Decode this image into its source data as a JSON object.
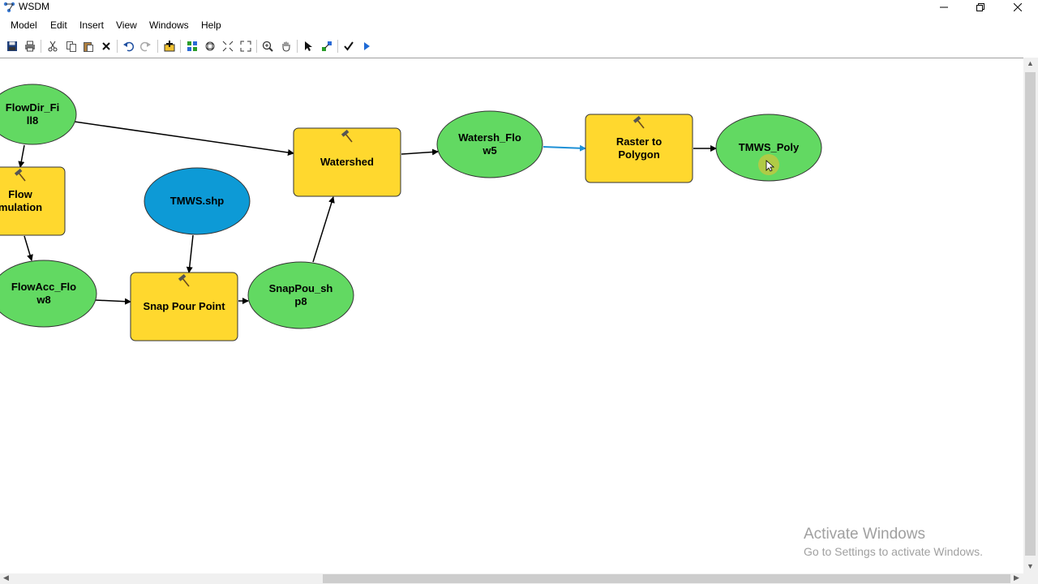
{
  "window": {
    "title": "WSDM",
    "minimize_label": "minimize",
    "maximize_label": "restore",
    "close_label": "close"
  },
  "menu": [
    "Model",
    "Edit",
    "Insert",
    "View",
    "Windows",
    "Help"
  ],
  "toolbar": [
    {
      "icon": "save-icon"
    },
    {
      "icon": "print-icon"
    },
    {
      "icon": "cut-icon"
    },
    {
      "icon": "copy-icon"
    },
    {
      "icon": "paste-icon"
    },
    {
      "icon": "delete-icon"
    },
    {
      "icon": "undo-icon"
    },
    {
      "icon": "redo-icon"
    },
    {
      "icon": "add-data-icon"
    },
    {
      "icon": "auto-layout-icon"
    },
    {
      "icon": "full-extent-icon"
    },
    {
      "icon": "fixed-zoom-in-icon"
    },
    {
      "icon": "fixed-zoom-out-icon"
    },
    {
      "icon": "zoom-in-icon"
    },
    {
      "icon": "pan-icon"
    },
    {
      "icon": "select-icon"
    },
    {
      "icon": "connect-icon"
    },
    {
      "icon": "validate-icon"
    },
    {
      "icon": "run-icon"
    }
  ],
  "model": {
    "nodes": [
      {
        "id": "flowdir",
        "shape": "ellipse",
        "kind": "data",
        "lines": [
          "FlowDir_Fi",
          "ll8"
        ],
        "color": "#62d962"
      },
      {
        "id": "flowacc_tool",
        "shape": "rect",
        "kind": "tool",
        "lines": [
          "Flow",
          "mulation"
        ],
        "color": "#ffd82e"
      },
      {
        "id": "flowacc",
        "shape": "ellipse",
        "kind": "data",
        "lines": [
          "FlowAcc_Flo",
          "w8"
        ],
        "color": "#62d962"
      },
      {
        "id": "tmws",
        "shape": "ellipse",
        "kind": "input",
        "lines": [
          "TMWS.shp"
        ],
        "color": "#0d9ad6"
      },
      {
        "id": "snap",
        "shape": "rect",
        "kind": "tool",
        "lines": [
          "Snap Pour Point"
        ],
        "color": "#ffd82e"
      },
      {
        "id": "snappou",
        "shape": "ellipse",
        "kind": "data",
        "lines": [
          "SnapPou_sh",
          "p8"
        ],
        "color": "#62d962"
      },
      {
        "id": "watershed",
        "shape": "rect",
        "kind": "tool",
        "lines": [
          "Watershed"
        ],
        "color": "#ffd82e"
      },
      {
        "id": "watersh_flo",
        "shape": "ellipse",
        "kind": "data",
        "lines": [
          "Watersh_Flo",
          "w5"
        ],
        "color": "#62d962"
      },
      {
        "id": "raster2poly",
        "shape": "rect",
        "kind": "tool",
        "lines": [
          "Raster to",
          "Polygon"
        ],
        "color": "#ffd82e"
      },
      {
        "id": "tmws_poly",
        "shape": "ellipse",
        "kind": "data",
        "lines": [
          "TMWS_Poly"
        ],
        "color": "#62d962"
      }
    ],
    "connections": [
      {
        "from": "flowdir",
        "to": "watershed"
      },
      {
        "from": "flowdir",
        "to": "flowacc_tool"
      },
      {
        "from": "flowacc_tool",
        "to": "flowacc"
      },
      {
        "from": "flowacc",
        "to": "snap"
      },
      {
        "from": "tmws",
        "to": "snap"
      },
      {
        "from": "snap",
        "to": "snappou"
      },
      {
        "from": "snappou",
        "to": "watershed"
      },
      {
        "from": "watershed",
        "to": "watersh_flo"
      },
      {
        "from": "watersh_flo",
        "to": "raster2poly",
        "highlight": true
      },
      {
        "from": "raster2poly",
        "to": "tmws_poly"
      }
    ]
  },
  "watermark": {
    "title": "Activate Windows",
    "subtitle": "Go to Settings to activate Windows."
  }
}
